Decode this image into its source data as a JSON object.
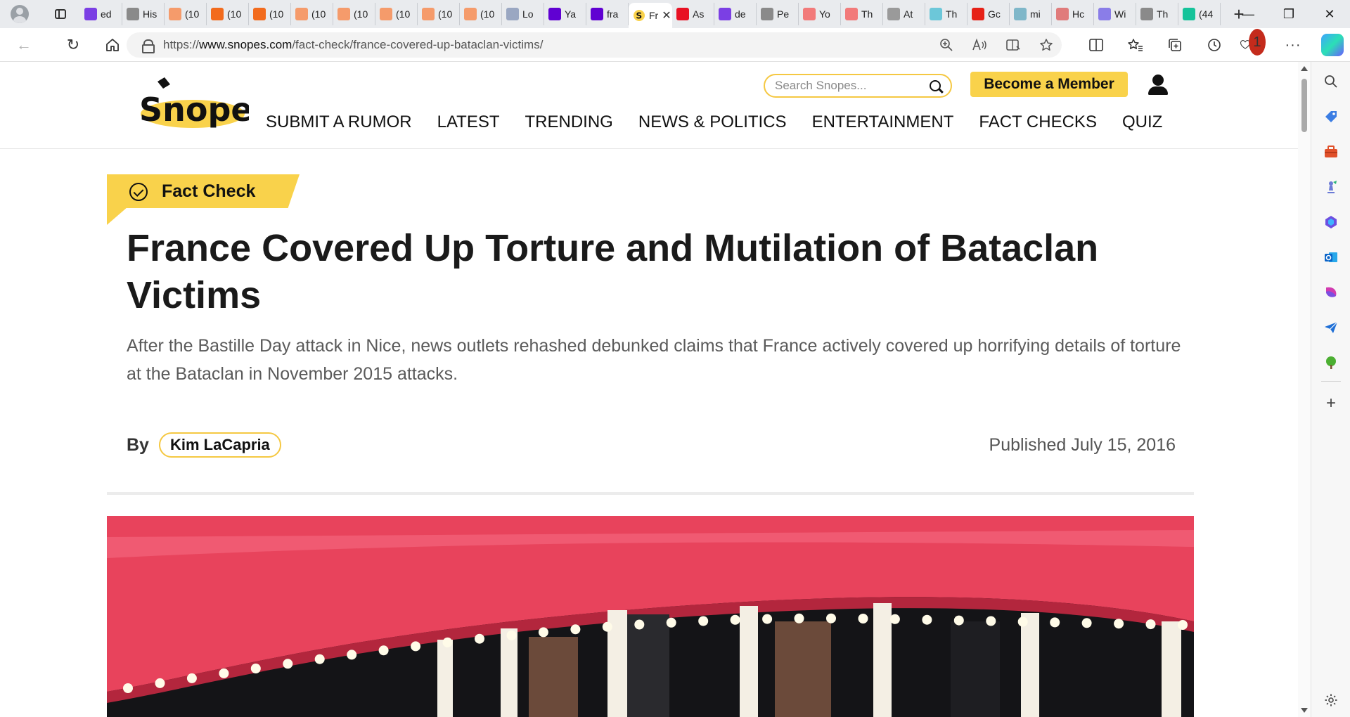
{
  "browser": {
    "tabs": [
      {
        "label": "ed",
        "icon": "yahoo-icon",
        "color": "#7b3fe4"
      },
      {
        "label": "His",
        "icon": "history-icon",
        "color": "#8a8a8a"
      },
      {
        "label": "(10",
        "icon": "bookmark-icon",
        "color": "#f59b6b"
      },
      {
        "label": "(10",
        "icon": "bookmark-icon",
        "color": "#f26b1d"
      },
      {
        "label": "(10",
        "icon": "bookmark-icon",
        "color": "#f26b1d"
      },
      {
        "label": "(10",
        "icon": "bookmark-icon",
        "color": "#f59b6b"
      },
      {
        "label": "(10",
        "icon": "bookmark-icon",
        "color": "#f59b6b"
      },
      {
        "label": "(10",
        "icon": "bookmark-icon",
        "color": "#f59b6b"
      },
      {
        "label": "(10",
        "icon": "bookmark-icon",
        "color": "#f59b6b"
      },
      {
        "label": "(10",
        "icon": "bookmark-icon",
        "color": "#f59b6b"
      },
      {
        "label": "Lo",
        "icon": "letter-l-icon",
        "color": "#9aa7c2"
      },
      {
        "label": "Ya",
        "icon": "yahoo-icon",
        "color": "#6001d2"
      },
      {
        "label": "fra",
        "icon": "yahoo-icon",
        "color": "#6001d2"
      },
      {
        "label": "Fr",
        "icon": "snopes-icon",
        "color": "#ffffff",
        "active": true
      },
      {
        "label": "As",
        "icon": "shield-icon",
        "color": "#e81123"
      },
      {
        "label": "de",
        "icon": "yahoo-icon",
        "color": "#7b3fe4"
      },
      {
        "label": "Pe",
        "icon": "person-icon",
        "color": "#8a8a8a"
      },
      {
        "label": "Yo",
        "icon": "youtube-icon",
        "color": "#f27a7a"
      },
      {
        "label": "Th",
        "icon": "youtube-icon",
        "color": "#f27a7a"
      },
      {
        "label": "At",
        "icon": "document-icon",
        "color": "#9a9a9a"
      },
      {
        "label": "Th",
        "icon": "arrow-icon",
        "color": "#6cc7d9"
      },
      {
        "label": "Gc",
        "icon": "youtube-icon",
        "color": "#e62117"
      },
      {
        "label": "mi",
        "icon": "chart-icon",
        "color": "#7fb7c9"
      },
      {
        "label": "Hc",
        "icon": "person-icon",
        "color": "#e07b7b"
      },
      {
        "label": "Wi",
        "icon": "shield-icon",
        "color": "#8a7de8"
      },
      {
        "label": "Th",
        "icon": "dots-icon",
        "color": "#8a8a8a"
      },
      {
        "label": "(44",
        "icon": "letter-g-icon",
        "color": "#15c39a"
      }
    ],
    "active_close": "✕",
    "new_tab": "+",
    "window": {
      "minimize": "—",
      "restore": "❐",
      "close": "✕"
    },
    "url_prefix": "https://",
    "url_host": "www.snopes.com",
    "url_path": "/fact-check/france-covered-up-bataclan-victims/",
    "notification_count": "1"
  },
  "site": {
    "logo_text": "Snopes",
    "search_placeholder": "Search Snopes...",
    "member_button": "Become a Member",
    "nav": [
      "SUBMIT A RUMOR",
      "LATEST",
      "TRENDING",
      "NEWS & POLITICS",
      "ENTERTAINMENT",
      "FACT CHECKS",
      "QUIZ"
    ]
  },
  "article": {
    "kicker": "Fact Check",
    "title": "France Covered Up Torture and Mutilation of Bataclan Victims",
    "dek": "After the Bastille Day attack in Nice, news outlets rehashed debunked claims that France actively covered up horrifying details of torture at the Bataclan in November 2015 attacks.",
    "by_label": "By",
    "author": "Kim LaCapria",
    "published": "Published July 15, 2016"
  },
  "colors": {
    "accent": "#f9d24b",
    "text": "#1a1a1a",
    "muted": "#5a5a5a"
  }
}
